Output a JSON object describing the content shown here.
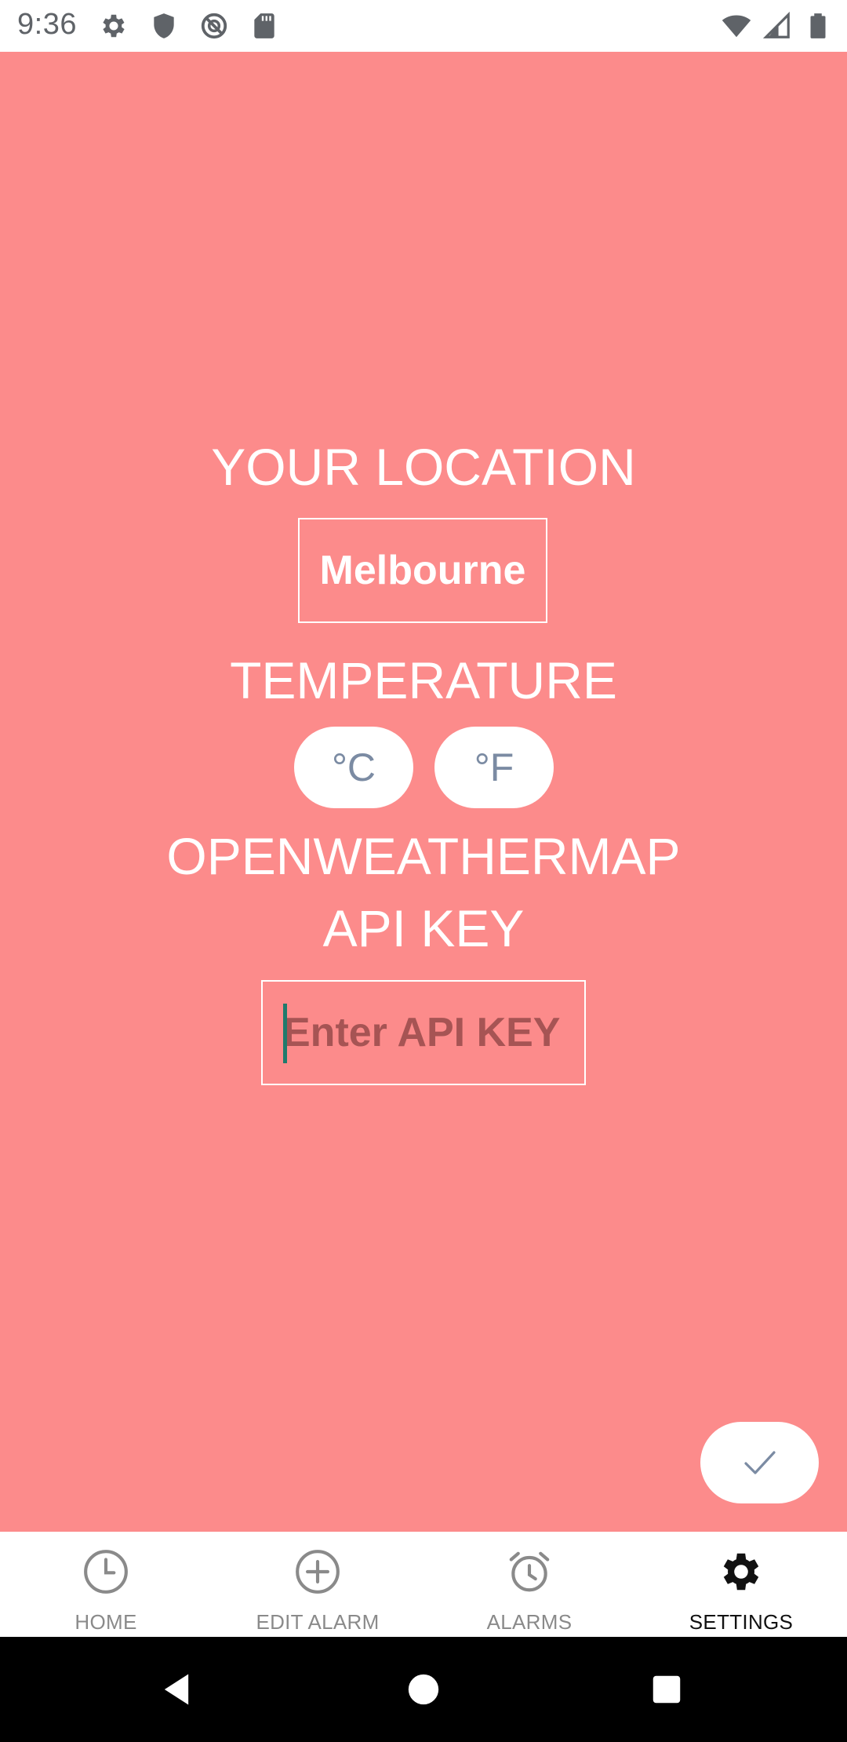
{
  "status_bar": {
    "time": "9:36",
    "left_icons": [
      "settings-icon",
      "shield-icon",
      "do-not-disturb-icon",
      "sd-card-icon"
    ],
    "right_icons": [
      "wifi-icon",
      "cell-signal-icon",
      "battery-icon"
    ]
  },
  "settings": {
    "location_heading": "YOUR LOCATION",
    "location_value": "Melbourne",
    "temperature_heading": "TEMPERATURE",
    "unit_celsius": "°C",
    "unit_fahrenheit": "°F",
    "api_heading_line1": "OPENWEATHERMAP",
    "api_heading_line2": "API KEY",
    "api_placeholder": "Enter API KEY",
    "api_value": ""
  },
  "fab": {
    "icon": "checkmark-icon"
  },
  "bottom_nav": {
    "items": [
      {
        "label": "HOME",
        "icon": "clock-icon",
        "active": false
      },
      {
        "label": "EDIT ALARM",
        "icon": "add-circle-icon",
        "active": false
      },
      {
        "label": "ALARMS",
        "icon": "alarm-clock-icon",
        "active": false
      },
      {
        "label": "SETTINGS",
        "icon": "gear-icon",
        "active": true
      }
    ]
  },
  "colors": {
    "background": "#fc8b8b",
    "text_on_background": "#ffffff",
    "unit_text": "#7b8ba3",
    "placeholder_text": "#a65454",
    "nav_inactive": "#8a8a8a",
    "nav_active": "#111111"
  }
}
